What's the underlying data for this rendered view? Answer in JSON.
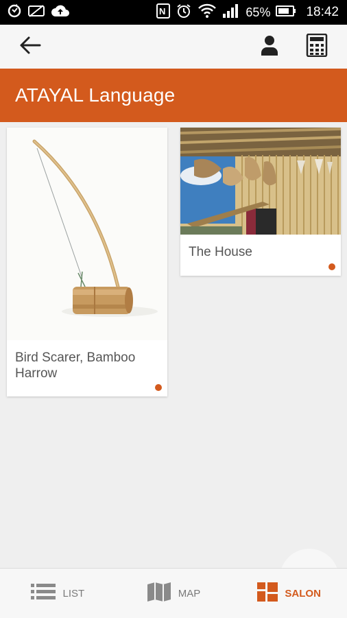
{
  "status_bar": {
    "battery_percent": "65%",
    "time": "18:42",
    "icons": [
      "sync-icon",
      "sim-off-icon",
      "cloud-upload-icon",
      "nfc-icon",
      "alarm-icon",
      "wifi-icon",
      "signal-icon",
      "battery-icon"
    ]
  },
  "app_bar": {
    "icons": [
      "back-arrow-icon",
      "person-icon",
      "calculator-icon"
    ]
  },
  "header": {
    "title": "ATAYAL Language",
    "accent_color": "#d35a1d"
  },
  "cards": [
    {
      "label": "Bird Scarer, Bamboo Harrow",
      "image": "bird-scarer-photo"
    },
    {
      "label": "The House",
      "image": "house-photo"
    }
  ],
  "bottom_nav": {
    "items": [
      {
        "label": "LIST",
        "icon": "list-icon",
        "active": false
      },
      {
        "label": "MAP",
        "icon": "map-icon",
        "active": false
      },
      {
        "label": "SALON",
        "icon": "salon-grid-icon",
        "active": true
      }
    ]
  }
}
